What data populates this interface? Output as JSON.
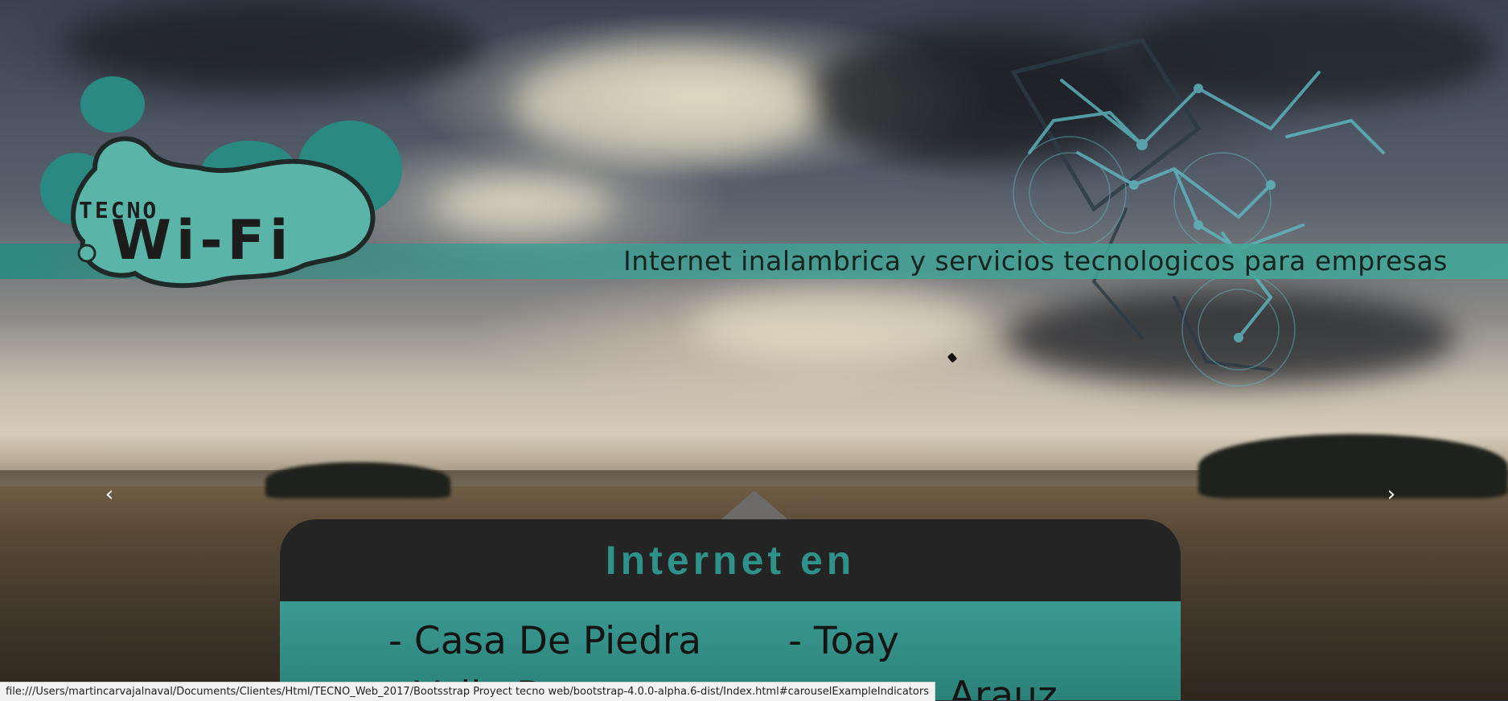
{
  "brand": {
    "logo_top": "TECNO",
    "logo_main": "Wi-Fi",
    "tagline": "Internet inalambrica y servicios tecnologicos para empresas",
    "accent": "#2e928a"
  },
  "carousel": {
    "prev_icon": "chevron-left-icon",
    "next_icon": "chevron-right-icon",
    "prev_glyph": "‹",
    "next_glyph": "›"
  },
  "card": {
    "title": "Internet en",
    "locations": [
      "- Casa De Piedra",
      "- Toay",
      "- Valle D",
      "- Arauz"
    ]
  },
  "status_url": "file:///Users/martincarvajalnaval/Documents/Clientes/Html/TECNO_Web_2017/Bootsstrap Proyect tecno web/bootstrap-4.0.0-alpha.6-dist/Index.html#carouselExampleIndicators"
}
